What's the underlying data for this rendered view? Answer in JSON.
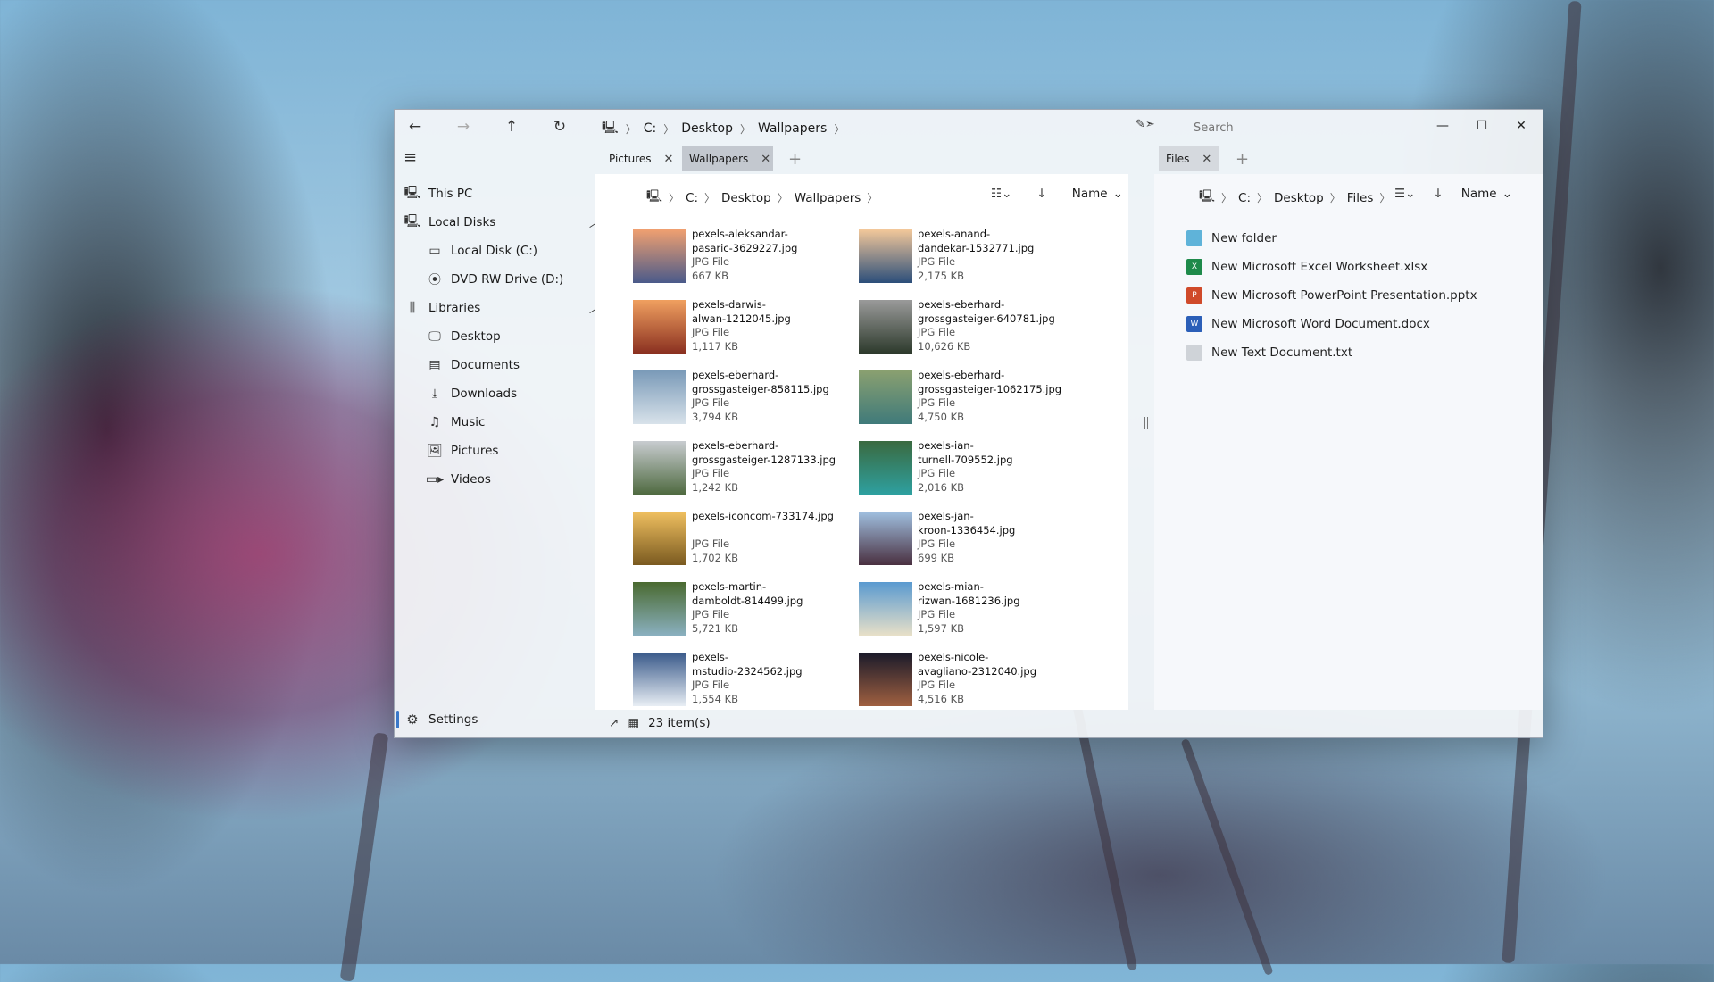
{
  "titlebar": {
    "back_icon": "arrow-left-icon",
    "forward_icon": "arrow-right-icon",
    "up_icon": "arrow-up-icon",
    "refresh_icon": "refresh-icon",
    "path": [
      "C:",
      "Desktop",
      "Wallpapers"
    ],
    "search_placeholder": "Search",
    "minimize": "—",
    "maximize": "☐",
    "close": "✕"
  },
  "tabs_left": [
    {
      "label": "Pictures",
      "active": false
    },
    {
      "label": "Wallpapers",
      "active": true
    }
  ],
  "tabs_right": [
    {
      "label": "Files",
      "active": true
    }
  ],
  "sidebar": {
    "this_pc": "This PC",
    "local_disks": "Local Disks",
    "local_disk_c": "Local Disk (C:)",
    "dvd_drive": "DVD RW Drive (D:)",
    "libraries": "Libraries",
    "desktop": "Desktop",
    "documents": "Documents",
    "downloads": "Downloads",
    "music": "Music",
    "pictures": "Pictures",
    "videos": "Videos",
    "settings": "Settings"
  },
  "left_pane": {
    "path": [
      "C:",
      "Desktop",
      "Wallpapers"
    ],
    "sort_label": "Name",
    "files": [
      {
        "name1": "pexels-aleksandar-",
        "name2": "pasaric-3629227.jpg",
        "type": "JPG File",
        "size": "667 KB",
        "colors": [
          "#f0a070",
          "#4a5a8a"
        ]
      },
      {
        "name1": "pexels-anand-",
        "name2": "dandekar-1532771.jpg",
        "type": "JPG File",
        "size": "2,175 KB",
        "colors": [
          "#f3c89a",
          "#2b4e7a"
        ]
      },
      {
        "name1": "pexels-darwis-",
        "name2": "alwan-1212045.jpg",
        "type": "JPG File",
        "size": "1,117 KB",
        "colors": [
          "#f0a060",
          "#8a3020"
        ]
      },
      {
        "name1": "pexels-eberhard-",
        "name2": "grossgasteiger-640781.jpg",
        "type": "JPG File",
        "size": "10,626 KB",
        "colors": [
          "#9a9a9a",
          "#2d3a2c"
        ]
      },
      {
        "name1": "pexels-eberhard-",
        "name2": "grossgasteiger-858115.jpg",
        "type": "JPG File",
        "size": "3,794 KB",
        "colors": [
          "#7a9ab8",
          "#d8e2ea"
        ]
      },
      {
        "name1": "pexels-eberhard-",
        "name2": "grossgasteiger-1062175.jpg",
        "type": "JPG File",
        "size": "4,750 KB",
        "colors": [
          "#8aa070",
          "#3f7a7a"
        ]
      },
      {
        "name1": "pexels-eberhard-",
        "name2": "grossgasteiger-1287133.jpg",
        "type": "JPG File",
        "size": "1,242 KB",
        "colors": [
          "#c8ccd0",
          "#4f6a40"
        ]
      },
      {
        "name1": "pexels-ian-",
        "name2": "turnell-709552.jpg",
        "type": "JPG File",
        "size": "2,016 KB",
        "colors": [
          "#3a6a40",
          "#2ea0a0"
        ]
      },
      {
        "name1": "pexels-iconcom-733174.jpg",
        "name2": "",
        "type": "JPG File",
        "size": "1,702 KB",
        "colors": [
          "#f0c060",
          "#7a5a20"
        ]
      },
      {
        "name1": "pexels-jan-",
        "name2": "kroon-1336454.jpg",
        "type": "JPG File",
        "size": "699 KB",
        "colors": [
          "#a0c0e0",
          "#4a3040"
        ]
      },
      {
        "name1": "pexels-martin-",
        "name2": "damboldt-814499.jpg",
        "type": "JPG File",
        "size": "5,721 KB",
        "colors": [
          "#4a6a30",
          "#8ab0c0"
        ]
      },
      {
        "name1": "pexels-mian-",
        "name2": "rizwan-1681236.jpg",
        "type": "JPG File",
        "size": "1,597 KB",
        "colors": [
          "#5a9ad0",
          "#e8e0c8"
        ]
      },
      {
        "name1": "pexels-",
        "name2": "mstudio-2324562.jpg",
        "type": "JPG File",
        "size": "1,554 KB",
        "colors": [
          "#3a5a8a",
          "#e8eef4"
        ]
      },
      {
        "name1": "pexels-nicole-",
        "name2": "avagliano-2312040.jpg",
        "type": "JPG File",
        "size": "4,516 KB",
        "colors": [
          "#1a1a2a",
          "#a06040"
        ]
      }
    ],
    "status": "23 item(s)"
  },
  "right_pane": {
    "path": [
      "C:",
      "Desktop",
      "Files"
    ],
    "sort_label": "Name",
    "items": [
      {
        "label": "New folder",
        "icon": "folder-icon",
        "color": "#5fb3d9"
      },
      {
        "label": "New Microsoft Excel Worksheet.xlsx",
        "icon": "excel-icon",
        "color": "#1e8a4a"
      },
      {
        "label": "New Microsoft PowerPoint Presentation.pptx",
        "icon": "powerpoint-icon",
        "color": "#d04a2a"
      },
      {
        "label": "New Microsoft Word Document.docx",
        "icon": "word-icon",
        "color": "#2b5fb8"
      },
      {
        "label": "New Text Document.txt",
        "icon": "text-file-icon",
        "color": "#cfd3d8"
      }
    ]
  }
}
